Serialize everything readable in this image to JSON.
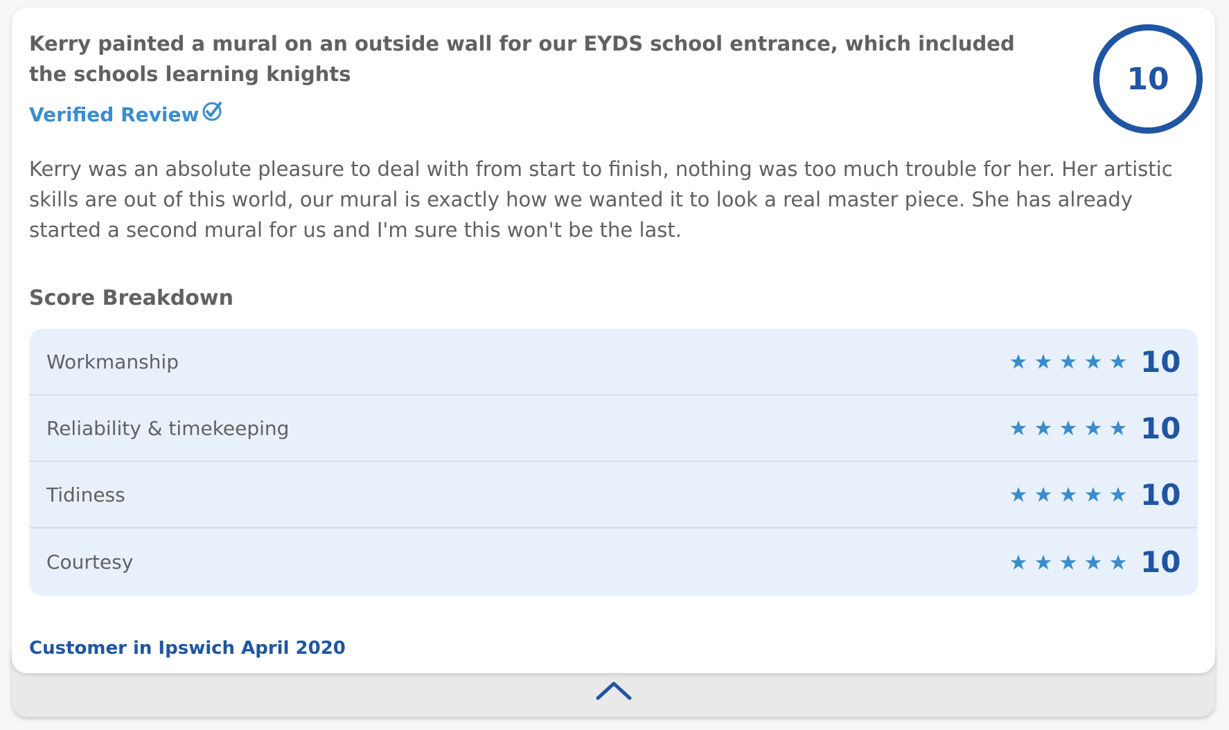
{
  "review": {
    "title": "Kerry painted a mural on an outside wall for our EYDS school entrance, which included the schools learning knights",
    "verified_label": "Verified Review",
    "overall_score": "10",
    "body": "Kerry was an absolute pleasure to deal with from start to finish, nothing was too much trouble for her. Her artistic skills are out of this world, our mural is exactly how we wanted it to look a real master piece. She has already started a second mural for us and I'm sure this won't be the last.",
    "breakdown_title": "Score Breakdown",
    "breakdown": [
      {
        "label": "Workmanship",
        "score": "10",
        "stars": 5
      },
      {
        "label": "Reliability & timekeeping",
        "score": "10",
        "stars": 5
      },
      {
        "label": "Tidiness",
        "score": "10",
        "stars": 5
      },
      {
        "label": "Courtesy",
        "score": "10",
        "stars": 5
      }
    ],
    "footer": "Customer in Ipswich April 2020"
  },
  "icons": {
    "verified": "check-circle-icon",
    "star": "star-icon",
    "collapse": "chevron-up-icon"
  },
  "colors": {
    "accent_dark": "#1f55a3",
    "accent_light": "#3a8dcc",
    "breakdown_bg": "#e8f1fb"
  }
}
